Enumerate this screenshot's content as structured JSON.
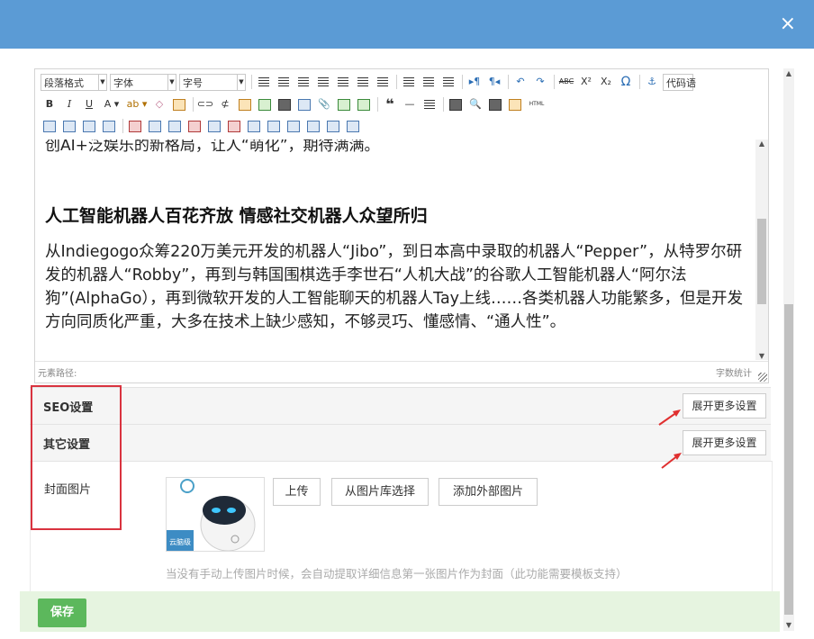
{
  "dialog": {
    "close_icon": "×"
  },
  "toolbar": {
    "paragraph_format": "段落格式",
    "font_family": "字体",
    "font_size": "字号",
    "code_lang": "代码语",
    "html_label": "HTML",
    "bold": "B",
    "italic": "I",
    "underline": "U",
    "font_color": "A",
    "superscript": "X²",
    "subscript": "X₂",
    "omega": "Ω",
    "quote": "❝"
  },
  "editor": {
    "cut_line": "创AI+泛娱乐的新格局，让人“萌化”，期待满满。",
    "heading": "人工智能机器人百花齐放 情感社交机器人众望所归",
    "paragraph": "从Indiegogo众筹220万美元开发的机器人“Jibo”，到日本高中录取的机器人“Pepper”，从特罗尔研发的机器人“Robby”，再到与韩国围棋选手李世石“人机大战”的谷歌人工智能机器人“阿尔法狗”(AlphaGo），再到微软开发的人工智能聊天的机器人Tay上线……各类机器人功能繁多，但是开发方向同质化严重，大多在技术上缺少感知，不够灵巧、懂感情、“通人性”。",
    "element_path": "元素路径:",
    "word_count": "字数统计"
  },
  "settings": {
    "seo_label": "SEO设置",
    "other_label": "其它设置",
    "expand_more": "展开更多设置"
  },
  "cover": {
    "label": "封面图片",
    "thumbnail_caption": "云脑级",
    "upload": "上传",
    "from_library": "从图片库选择",
    "add_external": "添加外部图片",
    "hint": "当没有手动上传图片时候，会自动提取详细信息第一张图片作为封面（此功能需要模板支持）"
  },
  "footer": {
    "save": "保存"
  },
  "colors": {
    "titlebar": "#5b9bd5",
    "save": "#5cb85c",
    "highlight": "#d9333f"
  }
}
